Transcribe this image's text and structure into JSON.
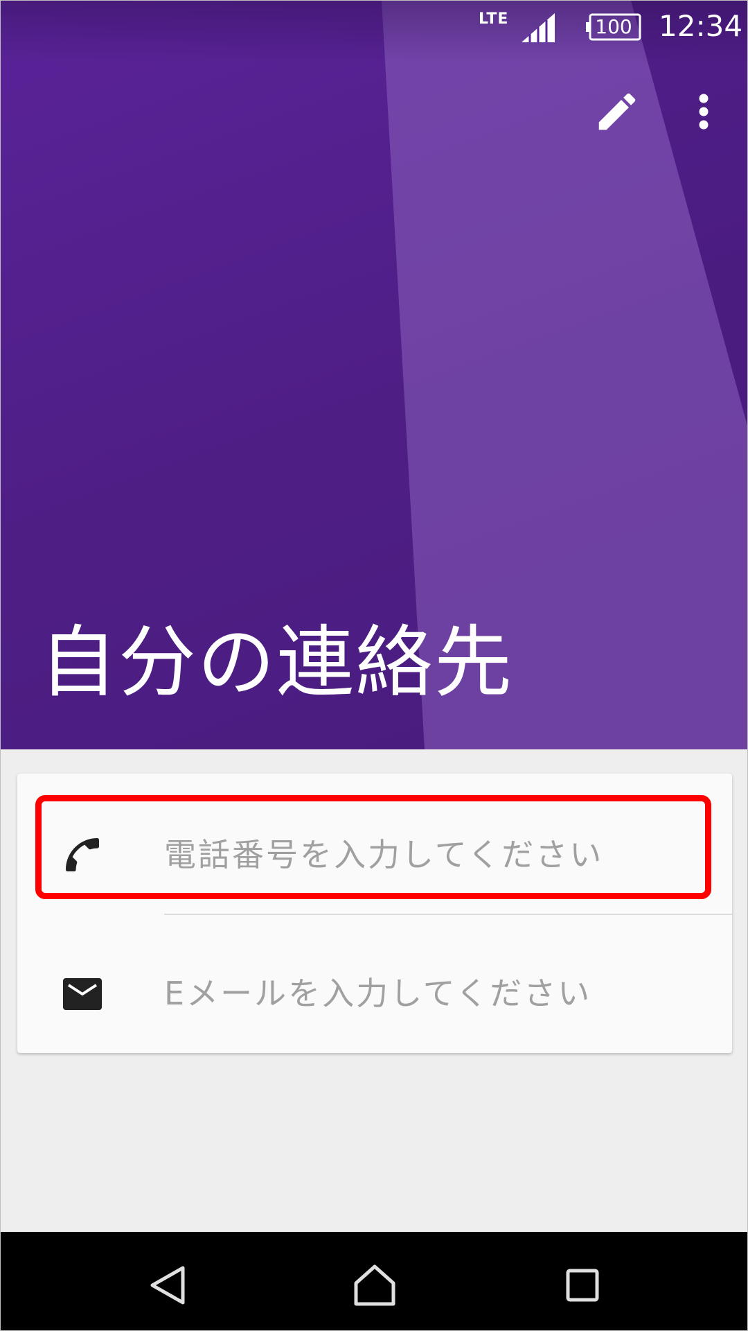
{
  "status_bar": {
    "network": "LTE",
    "battery": "100",
    "time": "12:34"
  },
  "header": {
    "title": "自分の連絡先",
    "accent_color": "#5a2399"
  },
  "actions": {
    "edit_icon": "pencil-icon",
    "more_icon": "more-vert-icon"
  },
  "fields": {
    "phone": {
      "icon": "phone-icon",
      "value": "",
      "placeholder": "電話番号を入力してください"
    },
    "email": {
      "icon": "mail-icon",
      "value": "",
      "placeholder": "Eメールを入力してください"
    }
  },
  "highlight_color": "#ff0000",
  "nav": {
    "back_icon": "back-triangle-icon",
    "home_icon": "home-icon",
    "recent_icon": "recent-apps-icon"
  }
}
